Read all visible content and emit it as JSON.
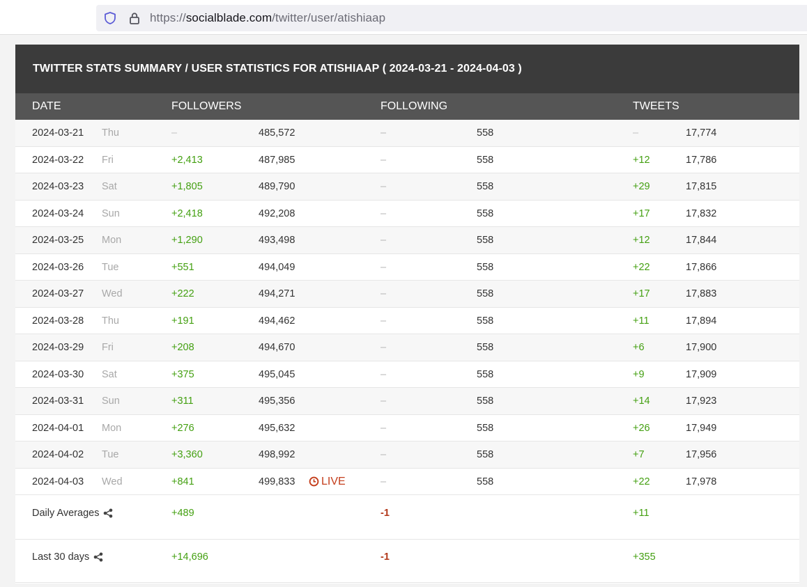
{
  "browser": {
    "url_prefix": "https://",
    "url_host": "socialblade.com",
    "url_path": "/twitter/user/atishiaap",
    "icons": [
      "shield-icon",
      "lock-icon"
    ]
  },
  "table": {
    "title": "TWITTER STATS SUMMARY / USER STATISTICS FOR ATISHIAAP ( 2024-03-21 - 2024-04-03 )",
    "headers": {
      "date": "DATE",
      "followers": "FOLLOWERS",
      "following": "FOLLOWING",
      "tweets": "TWEETS"
    },
    "rows": [
      {
        "date": "2024-03-21",
        "day": "Thu",
        "followers_delta": "–",
        "followers": "485,572",
        "following_delta": "–",
        "following": "558",
        "tweets_delta": "–",
        "tweets": "17,774"
      },
      {
        "date": "2024-03-22",
        "day": "Fri",
        "followers_delta": "+2,413",
        "followers": "487,985",
        "following_delta": "–",
        "following": "558",
        "tweets_delta": "+12",
        "tweets": "17,786"
      },
      {
        "date": "2024-03-23",
        "day": "Sat",
        "followers_delta": "+1,805",
        "followers": "489,790",
        "following_delta": "–",
        "following": "558",
        "tweets_delta": "+29",
        "tweets": "17,815"
      },
      {
        "date": "2024-03-24",
        "day": "Sun",
        "followers_delta": "+2,418",
        "followers": "492,208",
        "following_delta": "–",
        "following": "558",
        "tweets_delta": "+17",
        "tweets": "17,832"
      },
      {
        "date": "2024-03-25",
        "day": "Mon",
        "followers_delta": "+1,290",
        "followers": "493,498",
        "following_delta": "–",
        "following": "558",
        "tweets_delta": "+12",
        "tweets": "17,844"
      },
      {
        "date": "2024-03-26",
        "day": "Tue",
        "followers_delta": "+551",
        "followers": "494,049",
        "following_delta": "–",
        "following": "558",
        "tweets_delta": "+22",
        "tweets": "17,866"
      },
      {
        "date": "2024-03-27",
        "day": "Wed",
        "followers_delta": "+222",
        "followers": "494,271",
        "following_delta": "–",
        "following": "558",
        "tweets_delta": "+17",
        "tweets": "17,883"
      },
      {
        "date": "2024-03-28",
        "day": "Thu",
        "followers_delta": "+191",
        "followers": "494,462",
        "following_delta": "–",
        "following": "558",
        "tweets_delta": "+11",
        "tweets": "17,894"
      },
      {
        "date": "2024-03-29",
        "day": "Fri",
        "followers_delta": "+208",
        "followers": "494,670",
        "following_delta": "–",
        "following": "558",
        "tweets_delta": "+6",
        "tweets": "17,900"
      },
      {
        "date": "2024-03-30",
        "day": "Sat",
        "followers_delta": "+375",
        "followers": "495,045",
        "following_delta": "–",
        "following": "558",
        "tweets_delta": "+9",
        "tweets": "17,909"
      },
      {
        "date": "2024-03-31",
        "day": "Sun",
        "followers_delta": "+311",
        "followers": "495,356",
        "following_delta": "–",
        "following": "558",
        "tweets_delta": "+14",
        "tweets": "17,923"
      },
      {
        "date": "2024-04-01",
        "day": "Mon",
        "followers_delta": "+276",
        "followers": "495,632",
        "following_delta": "–",
        "following": "558",
        "tweets_delta": "+26",
        "tweets": "17,949"
      },
      {
        "date": "2024-04-02",
        "day": "Tue",
        "followers_delta": "+3,360",
        "followers": "498,992",
        "following_delta": "–",
        "following": "558",
        "tweets_delta": "+7",
        "tweets": "17,956"
      },
      {
        "date": "2024-04-03",
        "day": "Wed",
        "followers_delta": "+841",
        "followers": "499,833",
        "live": "LIVE",
        "following_delta": "–",
        "following": "558",
        "tweets_delta": "+22",
        "tweets": "17,978"
      }
    ],
    "summary": [
      {
        "label": "Daily Averages",
        "followers": "+489",
        "following": "-1",
        "tweets": "+11"
      },
      {
        "label": "Last 30 days",
        "followers": "+14,696",
        "following": "-1",
        "tweets": "+355"
      }
    ]
  },
  "colors": {
    "positive": "#44a012",
    "negative": "#b2391b",
    "live": "#c43e1c",
    "title_bg": "#3b3b3b",
    "header_bg": "#555555"
  }
}
